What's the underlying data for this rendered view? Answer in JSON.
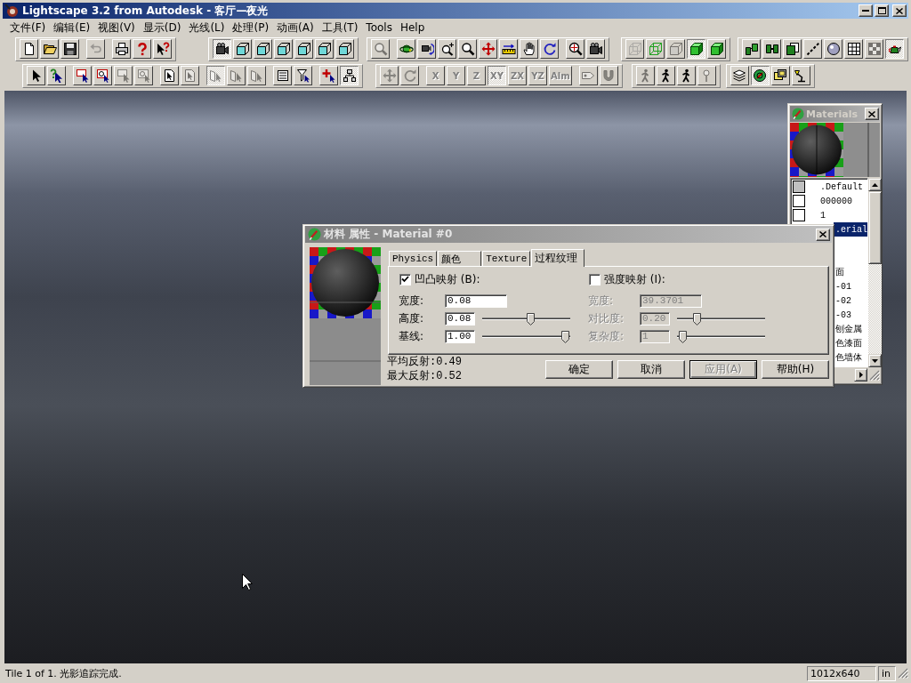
{
  "window": {
    "title": "Lightscape 3.2 from Autodesk - 客厅—夜光"
  },
  "menu": [
    "文件(F)",
    "编辑(E)",
    "视图(V)",
    "显示(D)",
    "光线(L)",
    "处理(P)",
    "动画(A)",
    "工具(T)",
    "Tools",
    "Help"
  ],
  "toolbars": [
    {
      "bands": [
        {
          "clusters": [
            [
              {
                "pressed": false,
                "disabled": false
              },
              {
                "pressed": false,
                "disabled": false
              },
              {
                "pressed": false,
                "disabled": false
              }
            ],
            [
              {
                "pressed": false,
                "disabled": true
              }
            ],
            [
              {
                "pressed": false,
                "disabled": false
              },
              {
                "pressed": false,
                "disabled": false
              },
              {
                "pressed": false,
                "disabled": false
              }
            ]
          ]
        },
        {
          "clusters": [
            [
              {
                "pressed": true,
                "disabled": false
              },
              {
                "pressed": false,
                "disabled": false
              },
              {
                "pressed": false,
                "disabled": false
              },
              {
                "pressed": false,
                "disabled": false
              },
              {
                "pressed": false,
                "disabled": false
              },
              {
                "pressed": false,
                "disabled": false
              },
              {
                "pressed": false,
                "disabled": false
              }
            ]
          ]
        },
        {
          "clusters": [
            [
              {
                "pressed": false,
                "disabled": true
              }
            ],
            [
              {
                "pressed": false,
                "disabled": false
              },
              {
                "pressed": false,
                "disabled": false
              },
              {
                "pressed": false,
                "disabled": false
              },
              {
                "pressed": false,
                "disabled": false
              },
              {
                "pressed": false,
                "disabled": false
              },
              {
                "pressed": false,
                "disabled": false
              },
              {
                "pressed": false,
                "disabled": false
              },
              {
                "pressed": false,
                "disabled": false
              }
            ],
            [
              {
                "pressed": false,
                "disabled": false
              },
              {
                "pressed": false,
                "disabled": false
              }
            ]
          ]
        },
        {
          "clusters": [
            [
              {
                "pressed": false,
                "disabled": true
              },
              {
                "pressed": false,
                "disabled": false
              },
              {
                "pressed": false,
                "disabled": true
              },
              {
                "pressed": true,
                "disabled": false
              },
              {
                "pressed": false,
                "disabled": false
              }
            ]
          ]
        },
        {
          "clusters": [
            [
              {
                "pressed": false,
                "disabled": false
              },
              {
                "pressed": false,
                "disabled": false
              },
              {
                "pressed": false,
                "disabled": false
              },
              {
                "pressed": false,
                "disabled": false
              },
              {
                "pressed": false,
                "disabled": false
              },
              {
                "pressed": false,
                "disabled": false
              },
              {
                "pressed": false,
                "disabled": true
              },
              {
                "pressed": true,
                "disabled": false
              }
            ]
          ]
        }
      ]
    },
    {
      "bands": [
        {
          "clusters": [
            [
              {
                "pressed": false,
                "disabled": false
              },
              {
                "pressed": false,
                "disabled": false
              }
            ],
            [
              {
                "pressed": false,
                "disabled": false
              },
              {
                "pressed": false,
                "disabled": false
              },
              {
                "pressed": false,
                "disabled": true
              },
              {
                "pressed": false,
                "disabled": true
              }
            ],
            [
              {
                "pressed": false,
                "disabled": false
              },
              {
                "pressed": false,
                "disabled": true
              }
            ],
            [
              {
                "pressed": true,
                "disabled": true
              },
              {
                "pressed": false,
                "disabled": true
              },
              {
                "pressed": false,
                "disabled": true
              }
            ],
            [
              {
                "pressed": false,
                "disabled": false
              },
              {
                "pressed": false,
                "disabled": false
              }
            ],
            [
              {
                "pressed": false,
                "disabled": false
              },
              {
                "pressed": true,
                "disabled": false
              }
            ]
          ]
        },
        {
          "clusters": [
            [
              {
                "pressed": false,
                "disabled": true
              },
              {
                "pressed": false,
                "disabled": true
              }
            ],
            [
              {
                "label": "X",
                "pressed": false,
                "disabled": true
              },
              {
                "label": "Y",
                "pressed": false,
                "disabled": true
              },
              {
                "label": "Z",
                "pressed": false,
                "disabled": true
              },
              {
                "label": "XY",
                "pressed": true,
                "disabled": true
              },
              {
                "label": "ZX",
                "pressed": false,
                "disabled": true
              },
              {
                "label": "YZ",
                "pressed": false,
                "disabled": true
              },
              {
                "label": "Alm",
                "pressed": false,
                "disabled": true
              }
            ],
            [
              {
                "pressed": false,
                "disabled": true
              },
              {
                "pressed": false,
                "disabled": true
              }
            ]
          ]
        },
        {
          "clusters": [
            [
              {
                "pressed": false,
                "disabled": true
              },
              {
                "pressed": false,
                "disabled": false
              },
              {
                "pressed": false,
                "disabled": false
              },
              {
                "pressed": false,
                "disabled": true
              }
            ]
          ]
        },
        {
          "clusters": [
            [
              {
                "pressed": false,
                "disabled": false
              },
              {
                "pressed": true,
                "disabled": false
              },
              {
                "pressed": false,
                "disabled": false
              },
              {
                "pressed": false,
                "disabled": false
              }
            ]
          ]
        }
      ]
    }
  ],
  "materials_panel": {
    "title": "Materials",
    "items": [
      {
        "label": ".Default",
        "color": "#c0c0c0",
        "selected": false
      },
      {
        "label": "000000",
        "color": "#ffffff",
        "selected": false
      },
      {
        "label": "1",
        "color": "#ffffff",
        "selected": false
      }
    ],
    "covered_item_groups": [
      [
        {
          "label": ".erial",
          "selected": true
        }
      ],
      [
        {
          "label": "面",
          "selected": false
        },
        {
          "label": "-01",
          "selected": false
        },
        {
          "label": "-02",
          "selected": false
        },
        {
          "label": "-03",
          "selected": false
        },
        {
          "label": "刨金属",
          "selected": false
        },
        {
          "label": "色漆面",
          "selected": false
        },
        {
          "label": "色墙体",
          "selected": false
        }
      ]
    ]
  },
  "material_dialog": {
    "title": "材料 属性 - Material #0",
    "tabs": [
      {
        "label": "Physics",
        "selected": false
      },
      {
        "label": "颜色",
        "selected": false
      },
      {
        "label": "Texture",
        "selected": false
      },
      {
        "label": "过程纹理",
        "selected": true
      }
    ],
    "map_groups": [
      {
        "label": "凹凸映射 (B):",
        "checked": true,
        "fields": [
          {
            "label": "宽度:",
            "value": "0.08",
            "kind": "text"
          },
          {
            "label": "高度:",
            "value": "0.08",
            "kind": "slider",
            "level": 0.56
          },
          {
            "label": "基线:",
            "value": "1.00",
            "kind": "slider",
            "level": 0.99
          }
        ]
      },
      {
        "label": "强度映射 (I):",
        "checked": false,
        "fields": [
          {
            "label": "宽度:",
            "value": "39.3701",
            "kind": "text"
          },
          {
            "label": "对比度:",
            "value": "0.20",
            "kind": "slider",
            "level": 0.2
          },
          {
            "label": "复杂度:",
            "value": "1",
            "kind": "slider",
            "level": 0.02
          }
        ]
      }
    ],
    "stats": [
      "平均反射:0.49",
      "最大反射:0.52"
    ],
    "buttons": [
      {
        "label": "确定",
        "disabled": false,
        "default": false
      },
      {
        "label": "取消",
        "disabled": false,
        "default": false
      },
      {
        "label": "应用(A)",
        "disabled": true,
        "default": true
      },
      {
        "label": "帮助(H)",
        "disabled": false,
        "default": false
      }
    ]
  },
  "status_bar": {
    "message": "Tile 1 of 1. 光影追踪完成.",
    "resolution": "1012x640",
    "unit": "in"
  }
}
